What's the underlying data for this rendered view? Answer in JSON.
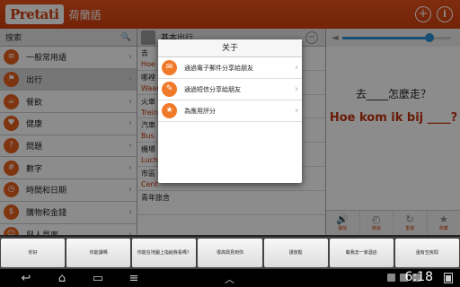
{
  "app": {
    "logo": "Pretati",
    "language": "荷蘭語"
  },
  "actionbar_icons": [
    "plus-icon",
    "info-icon"
  ],
  "left": {
    "search_label": "搜索",
    "categories": [
      {
        "label": "一般常用語",
        "icon": "book-icon"
      },
      {
        "label": "出行",
        "icon": "flag-icon",
        "selected": true
      },
      {
        "label": "餐飲",
        "icon": "cup-icon"
      },
      {
        "label": "健康",
        "icon": "heart-icon"
      },
      {
        "label": "問題",
        "icon": "question-icon"
      },
      {
        "label": "數字",
        "icon": "numbers-icon"
      },
      {
        "label": "時間和日期",
        "icon": "clock-icon"
      },
      {
        "label": "購物和金錢",
        "icon": "bag-icon"
      },
      {
        "label": "與人見面",
        "icon": "people-icon"
      }
    ]
  },
  "mid": {
    "header": "基本出行",
    "phrases": [
      {
        "native": "去",
        "target": "Hoe"
      },
      {
        "native": "哪裡",
        "target": "Waar"
      },
      {
        "native": "火車",
        "target": "Trein"
      },
      {
        "native": "汽車",
        "target": "Bus"
      },
      {
        "native": "機場",
        "target": "Luch"
      },
      {
        "native": "市區",
        "target": "Cent"
      },
      {
        "native": "青年旅舍",
        "target": ""
      }
    ]
  },
  "right": {
    "volume": 0.8,
    "question_native": "去____怎麼走？",
    "question_target": "Hoe kom ik bij ____?",
    "tools": [
      {
        "label": "播放",
        "icon": "speaker-icon"
      },
      {
        "label": "慢速",
        "icon": "snail-icon"
      },
      {
        "label": "重複",
        "icon": "repeat-icon"
      },
      {
        "label": "收藏",
        "icon": "star-icon"
      }
    ]
  },
  "dialog": {
    "title": "关于",
    "items": [
      {
        "label": "通過電子郵件分享給朋友",
        "icon": "envelope-icon"
      },
      {
        "label": "通過短信分享給朋友",
        "icon": "sms-icon"
      },
      {
        "label": "為應用評分",
        "icon": "star-icon"
      }
    ]
  },
  "strip": {
    "keys": [
      "你好",
      "你能讀嗎",
      "你能在地圖上指給我看嗎？",
      "很高興見到你",
      "請放鬆",
      "載我去一家酒店",
      "還有空房間"
    ]
  },
  "navbar": {
    "time": "6:18"
  }
}
